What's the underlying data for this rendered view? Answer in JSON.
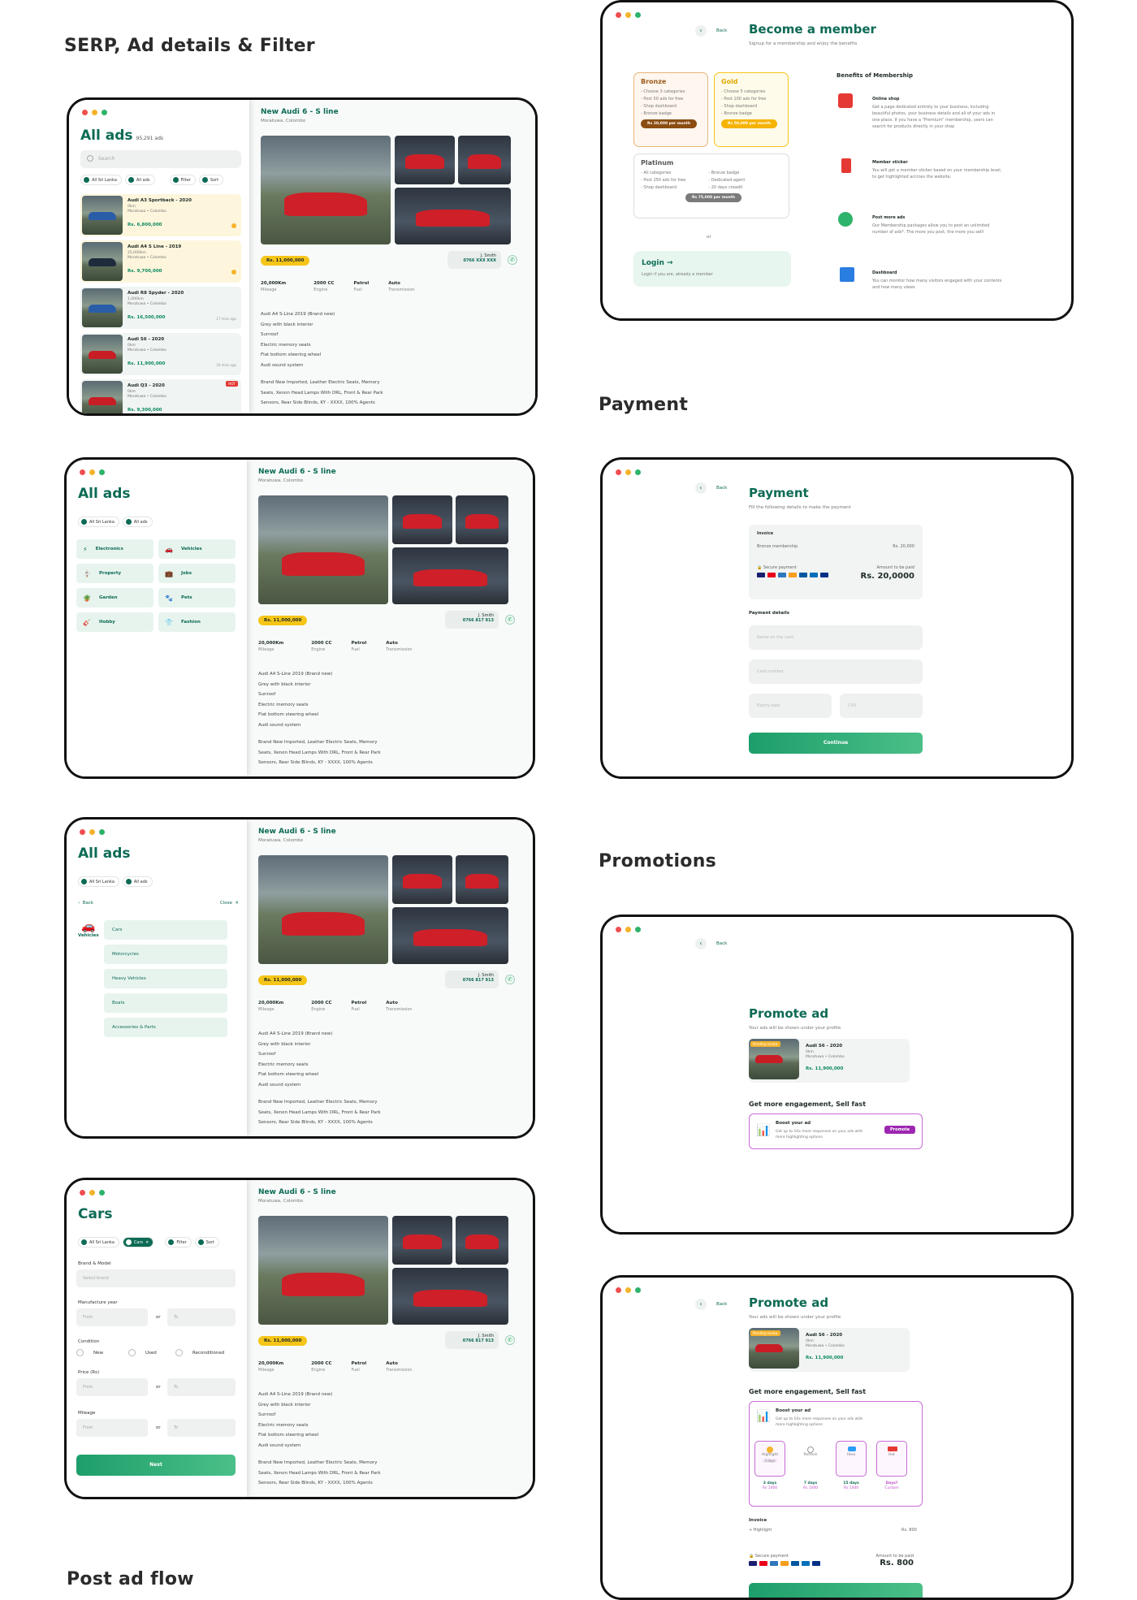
{
  "sections": {
    "serp": "SERP, Ad details & Filter",
    "payment": "Payment",
    "promotions": "Promotions",
    "post_ad": "Post ad flow"
  },
  "serp": {
    "title": "All ads",
    "count": "95,291 ads",
    "search_placeholder": "Search",
    "chip_location": "All Sri Lanka",
    "chip_category": "All ads",
    "chip_filter": "Filter",
    "chip_sort": "Sort",
    "listings": [
      {
        "title": "Audi A3 Sportback - 2020",
        "meta1": "0km",
        "meta2": "Moratuwa  •  Colombo",
        "price": "Rs. 6,800,000",
        "ago": ""
      },
      {
        "title": "Audi A4 S Line - 2019",
        "meta1": "25,000km",
        "meta2": "Moratuwa  •  Colombo",
        "price": "Rs. 9,700,000",
        "ago": ""
      },
      {
        "title": "Audi R8 Spyder - 2020",
        "meta1": "1,000km",
        "meta2": "Moratuwa  •  Colombo",
        "price": "Rs. 16,500,000",
        "ago": "17 mins ago"
      },
      {
        "title": "Audi S6 - 2020",
        "meta1": "0km",
        "meta2": "Moratuwa  •  Colombo",
        "price": "Rs. 11,900,000",
        "ago": "16 mins ago"
      },
      {
        "title": "Audi Q3 - 2020",
        "meta1": "0km",
        "meta2": "Moratuwa  •  Colombo",
        "price": "Rs. 9,300,000",
        "ago": "",
        "badge": "HOT"
      }
    ]
  },
  "detail": {
    "title": "New Audi 6 - S line",
    "location": "Moratuwa, Colombo",
    "price": "Rs. 11,000,000",
    "seller_name": "J. Smith",
    "seller_phone_masked": "0766 XXX XXX",
    "seller_phone": "0766 817 913",
    "specs": [
      {
        "value": "20,000Km",
        "label": "Mileage"
      },
      {
        "value": "2000 CC",
        "label": "Engine"
      },
      {
        "value": "Petrol",
        "label": "Fuel"
      },
      {
        "value": "Auto",
        "label": "Transmission"
      }
    ],
    "desc_lines": [
      "Audi A4 S-Line 2019 (Brand new)",
      "Grey with black interior",
      "Sunroof",
      "Electric memory seats",
      "Flat bottom steering wheel",
      "Audi sound system"
    ],
    "desc2_lines": [
      "Brand New Imported, Leather Electric Seats, Memory",
      "Seats, Xenon Head Lamps With DRL, Front & Rear Park",
      "Sensors, Rear Side Blinds, KY - XXXX, 100% Agents"
    ]
  },
  "categories": [
    {
      "icon": "⚡",
      "label": "Electronics"
    },
    {
      "icon": "🚗",
      "label": "Vehicles"
    },
    {
      "icon": "🪧",
      "label": "Property"
    },
    {
      "icon": "💼",
      "label": "Jobs"
    },
    {
      "icon": "🪴",
      "label": "Garden"
    },
    {
      "icon": "🐾",
      "label": "Pets"
    },
    {
      "icon": "🎸",
      "label": "Hobby"
    },
    {
      "icon": "👕",
      "label": "Fashion"
    }
  ],
  "subcat": {
    "back": "Back",
    "close": "Close",
    "parent": "Vehicles",
    "items": [
      "Cars",
      "Motorcycles",
      "Heavy Vehicles",
      "Boats",
      "Accessories & Parts"
    ]
  },
  "filter": {
    "title": "Cars",
    "chip_location": "All Sri Lanka",
    "chip_cat": "Cars",
    "chip_filter": "Filter",
    "chip_sort": "Sort",
    "brand_label": "Brand & Model",
    "brand_ph": "Select brand",
    "year_label": "Manufacture year",
    "from_ph": "From",
    "to_ph": "To",
    "or": "or",
    "condition_label": "Condition",
    "conditions": [
      "New",
      "Used",
      "Reconditioned"
    ],
    "price_label": "Price (Rs)",
    "mileage_label": "Mileage",
    "next": "Next"
  },
  "member": {
    "back": "Back",
    "title": "Become a member",
    "subtitle": "Signup for a membership and enjoy the benefits",
    "bronze": {
      "name": "Bronze",
      "lines": [
        "- Choose 3 categories",
        "- Post 50 ads for free",
        "- Shop dashboard",
        "- Bronze badge"
      ],
      "price": "Rs 20,000 per month"
    },
    "gold": {
      "name": "Gold",
      "lines": [
        "- Choose 5 categories",
        "- Post 100 ads for free",
        "- Shop dashboard",
        "- Bronze badge"
      ],
      "price": "Rs 50,000 per month"
    },
    "platinum": {
      "name": "Platinum",
      "lines1": [
        "- All categories",
        "- Post 250 ads for free",
        "- Shop dashboard"
      ],
      "lines2": [
        "- Bronze badge",
        "- Dedicated agent",
        "- 20 days creadit"
      ],
      "price": "Rs 75,000 per month"
    },
    "or": "or",
    "login": "Login",
    "login_sub": "Login if you are, already a member",
    "benefits_title": "Benefits of Membership",
    "benefits": [
      {
        "title": "Online shop",
        "text": "Get a page dedicated entirely to your business, including beautiful photos, your business details and all of your ads in one place. If you have a \"Premium\" membership, users can search for products directly in your shop"
      },
      {
        "title": "Member sticker",
        "text": "You will get a member sticker based on your membership level, to get highlighted accross the website."
      },
      {
        "title": "Post more ads",
        "text": "Our Membership packages allow you to post an unlimited number of ads*. The more you post, the more you sell!"
      },
      {
        "title": "Dashboard",
        "text": "You can monitor how many visitors engaged with your contents and how many views"
      }
    ]
  },
  "payment": {
    "back": "Back",
    "title": "Payment",
    "subtitle": "Fill the following details to make the payment",
    "invoice": "Invoice",
    "item": "Bronze membership",
    "item_price": "Rs. 20,000",
    "secure": "Secure payment",
    "amount_label": "Amount to be paid",
    "amount": "Rs. 20,0000",
    "details": "Payment details",
    "name_ph": "Name on the card",
    "card_ph": "Card number",
    "exp_ph": "Expiry date",
    "cvv_ph": "CVV",
    "continue": "Continue"
  },
  "promote1": {
    "back": "Back",
    "title": "Promote ad",
    "subtitle": "Your ads will be shown under your profile",
    "ad_title": "Audi S6 - 2020",
    "ad_meta1": "0km",
    "ad_meta2": "Moratuwa  •  Colombo",
    "ad_price": "Rs. 11,900,000",
    "ad_tag": "Pending review",
    "engage": "Get more engagement, Sell fast",
    "boost_title": "Boost your ad",
    "boost_text": "Get up to 10x more responses on your ads with more highlighting options",
    "promote": "Promote"
  },
  "promote2": {
    "options": [
      {
        "name": "Highlight",
        "sub": "3 days",
        "days": "3 days",
        "price": "Rs 1000"
      },
      {
        "name": "Refresh",
        "sub": "",
        "days": "7 days",
        "price": "Rs 1000"
      },
      {
        "name": "Hero",
        "sub": "",
        "days": "15 days",
        "price": "Rs 1000"
      },
      {
        "name": "Hot",
        "sub": "",
        "days": "Days?",
        "price": "Custom"
      }
    ],
    "invoice": "Invoice",
    "inv_item": "+ Highlight",
    "inv_price": "Rs. 800",
    "amount": "Rs. 800"
  }
}
